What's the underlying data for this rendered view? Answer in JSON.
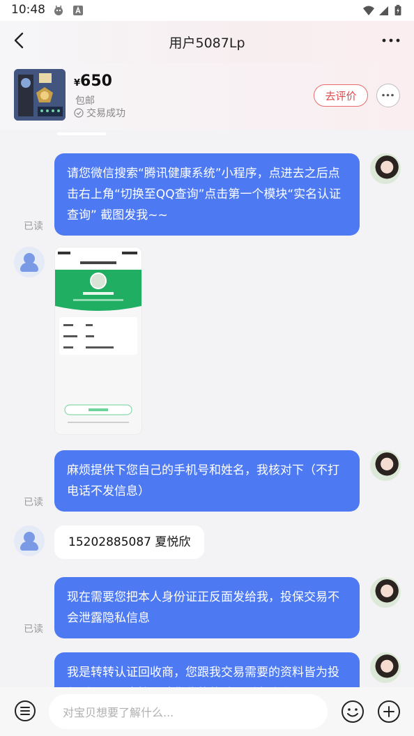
{
  "status": {
    "time": "10:48",
    "icons": [
      "android-debug-icon",
      "font-a-icon",
      "wifi-icon",
      "signal-icon",
      "battery-icon"
    ]
  },
  "nav": {
    "title": "用户5087Lp",
    "back_icon": "chevron-left-icon",
    "more_icon": "more-dots-icon"
  },
  "product": {
    "currency": "¥",
    "price": "650",
    "shipping": "包邮",
    "deal_status": "交易成功",
    "review_button": "去评价"
  },
  "messages": [
    {
      "from": "me",
      "text": "请您微信搜索“腾讯健康系统”小程序，点进去之后点击右上角“切换至QQ查询”点击第一个模块“实名认证查询” 截图发我~~",
      "read": "已读"
    },
    {
      "from": "them",
      "type": "image"
    },
    {
      "from": "me",
      "text": "麻烦提供下您自己的手机号和姓名，我核对下（不打电话不发信息）",
      "read": "已读"
    },
    {
      "from": "them",
      "text": "15202885087  夏悦欣"
    },
    {
      "from": "me",
      "text": "现在需要您把本人身份证正反面发给我，投保交易不会泄露隐私信息",
      "read": "已读"
    },
    {
      "from": "me",
      "text": "我是转转认证回收商，您跟我交易需要的资料皆为投保所用，是直接影响您收款的哦，所有隐私"
    }
  ],
  "input": {
    "placeholder": "对宝贝想要了解什么..."
  },
  "colors": {
    "accent": "#4d7af2",
    "review_red": "#e0474a"
  }
}
